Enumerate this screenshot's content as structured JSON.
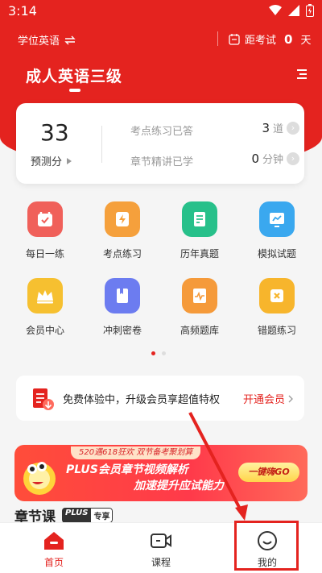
{
  "status_bar": {
    "time": "3:14"
  },
  "topbar": {
    "subject": "学位英语",
    "exam_prefix": "距考试",
    "exam_days": "0",
    "exam_unit": "天"
  },
  "course": {
    "title": "成人英语三级"
  },
  "stats": {
    "score": "33",
    "score_label": "预测分",
    "practice_label": "考点练习已答",
    "practice_value": "3",
    "practice_unit": "道",
    "lecture_label": "章节精讲已学",
    "lecture_value": "0",
    "lecture_unit": "分钟"
  },
  "features": [
    {
      "label": "每日一练",
      "icon": "calendar-check-icon",
      "color": "#f0605a"
    },
    {
      "label": "考点练习",
      "icon": "lightning-note-icon",
      "color": "#f5a03c"
    },
    {
      "label": "历年真题",
      "icon": "exam-paper-icon",
      "color": "#27c08a"
    },
    {
      "label": "模拟试题",
      "icon": "chart-board-icon",
      "color": "#3aa8ef"
    },
    {
      "label": "会员中心",
      "icon": "crown-icon",
      "color": "#f6c030"
    },
    {
      "label": "冲刺密卷",
      "icon": "book-icon",
      "color": "#6c7cf0"
    },
    {
      "label": "高频题库",
      "icon": "pulse-doc-icon",
      "color": "#f59a3a"
    },
    {
      "label": "错题练习",
      "icon": "error-x-icon",
      "color": "#f7b52c"
    }
  ],
  "member": {
    "text": "免费体验中，升级会员享超值特权",
    "action": "开通会员"
  },
  "promo": {
    "tag": "520遇618狂欢 双节备考聚划算",
    "main": "PLUS会员章节视频解析",
    "sub": "加速提升应试能力",
    "cta": "一键嗨GO"
  },
  "chapter": {
    "heading": "章节课",
    "badge_a": "PLUS",
    "badge_b": "专享"
  },
  "nav": [
    {
      "label": "首页",
      "icon": "home-icon"
    },
    {
      "label": "课程",
      "icon": "video-icon"
    },
    {
      "label": "我的",
      "icon": "smiley-icon"
    }
  ],
  "colors": {
    "brand": "#e4231f"
  }
}
